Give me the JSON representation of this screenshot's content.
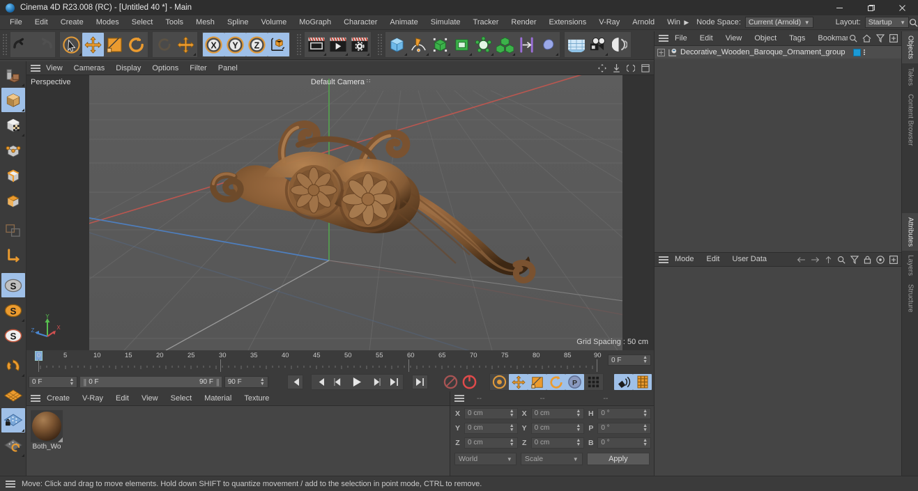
{
  "window": {
    "title": "Cinema 4D R23.008 (RC) - [Untitled 40 *] - Main",
    "minimize": "–",
    "maximize": "❐",
    "close": "✕"
  },
  "menubar": {
    "items": [
      "File",
      "Edit",
      "Create",
      "Modes",
      "Select",
      "Tools",
      "Mesh",
      "Spline",
      "Volume",
      "MoGraph",
      "Character",
      "Animate",
      "Simulate",
      "Tracker",
      "Render",
      "Extensions",
      "V-Ray",
      "Arnold",
      "Window"
    ],
    "overflow_arrow": "▶",
    "node_space_label": "Node Space:",
    "node_space_value": "Current (Arnold)",
    "layout_label": "Layout:",
    "layout_value": "Startup",
    "search_icon": "search-icon"
  },
  "toolbar": {
    "groups": [
      {
        "name": "history",
        "buttons": [
          {
            "name": "undo",
            "icon": "undo-icon",
            "active": false,
            "dim": false,
            "corner": false
          },
          {
            "name": "redo",
            "icon": "redo-icon",
            "active": false,
            "dim": true,
            "corner": false
          }
        ]
      },
      {
        "name": "transform-tools",
        "buttons": [
          {
            "name": "select",
            "icon": "live-selection-icon",
            "active": false,
            "dim": false,
            "corner": true
          },
          {
            "name": "move",
            "icon": "move-icon",
            "active": true,
            "dim": false,
            "corner": false
          },
          {
            "name": "scale",
            "icon": "scale-icon",
            "active": false,
            "dim": false,
            "corner": false
          },
          {
            "name": "rotate",
            "icon": "rotate-icon",
            "active": false,
            "dim": false,
            "corner": false
          }
        ]
      },
      {
        "name": "axis-lock",
        "buttons": [
          {
            "name": "last-used",
            "icon": "rotate-dim-icon",
            "active": false,
            "dim": true,
            "corner": false
          },
          {
            "name": "move-dup",
            "icon": "move-icon",
            "active": false,
            "dim": false,
            "corner": true
          }
        ]
      },
      {
        "name": "axis",
        "buttons": [
          {
            "name": "x-axis",
            "icon": "x-axis-icon",
            "active": true,
            "dim": false,
            "corner": false
          },
          {
            "name": "y-axis",
            "icon": "y-axis-icon",
            "active": true,
            "dim": false,
            "corner": false
          },
          {
            "name": "z-axis",
            "icon": "z-axis-icon",
            "active": true,
            "dim": false,
            "corner": false
          },
          {
            "name": "world-object-coord",
            "icon": "world-coord-icon",
            "active": false,
            "dim": false,
            "corner": false
          }
        ]
      },
      {
        "name": "render",
        "buttons": [
          {
            "name": "render-view",
            "icon": "render-view-icon",
            "active": false,
            "dim": false,
            "corner": true
          },
          {
            "name": "render-to-picture-viewer",
            "icon": "render-picture-viewer-icon",
            "active": false,
            "dim": false,
            "corner": true
          },
          {
            "name": "render-settings",
            "icon": "render-settings-icon",
            "active": false,
            "dim": false,
            "corner": true
          }
        ]
      },
      {
        "name": "create",
        "buttons": [
          {
            "name": "add-cube",
            "icon": "cube-icon",
            "active": false,
            "dim": false,
            "corner": true
          },
          {
            "name": "add-spline",
            "icon": "pen-spline-icon",
            "active": false,
            "dim": false,
            "corner": true
          },
          {
            "name": "add-nurbs",
            "icon": "generator-icon",
            "active": false,
            "dim": false,
            "corner": true
          },
          {
            "name": "add-array",
            "icon": "modeling-object-icon",
            "active": false,
            "dim": false,
            "corner": true
          },
          {
            "name": "add-deformer",
            "icon": "deformer-icon",
            "active": false,
            "dim": false,
            "corner": true
          },
          {
            "name": "add-mograph",
            "icon": "mograph-cloner-icon",
            "active": false,
            "dim": false,
            "corner": true
          },
          {
            "name": "add-scene",
            "icon": "scene-icon",
            "active": false,
            "dim": false,
            "corner": false
          },
          {
            "name": "add-field",
            "icon": "field-icon",
            "active": false,
            "dim": false,
            "corner": true
          }
        ]
      },
      {
        "name": "lighting",
        "buttons": [
          {
            "name": "add-sky",
            "icon": "sky-icon",
            "active": false,
            "dim": false,
            "corner": false
          },
          {
            "name": "add-camera",
            "icon": "camera-icon",
            "active": false,
            "dim": false,
            "corner": true
          },
          {
            "name": "add-light",
            "icon": "light-icon",
            "active": false,
            "dim": false,
            "corner": true
          }
        ]
      }
    ]
  },
  "left_toolbar": {
    "buttons": [
      {
        "name": "make-editable",
        "icon": "make-editable-icon",
        "active": false,
        "corner": true
      },
      {
        "name": "model-mode",
        "icon": "model-mode-icon",
        "active": true,
        "corner": true
      },
      {
        "name": "texture-mode",
        "icon": "texture-mode-icon",
        "active": false,
        "corner": true
      },
      {
        "name": "point-mode",
        "icon": "point-mode-icon",
        "active": false,
        "corner": false
      },
      {
        "name": "edge-mode",
        "icon": "edge-mode-icon",
        "active": false,
        "corner": false
      },
      {
        "name": "polygon-mode",
        "icon": "polygon-mode-icon",
        "active": false,
        "corner": false
      },
      {
        "name": "viewport-solo",
        "icon": "viewport-solo-icon",
        "active": false,
        "corner": false
      },
      {
        "name": "workplane",
        "icon": "workplane-axis-icon",
        "active": false,
        "corner": false
      },
      {
        "name": "enable-axis-modification",
        "icon": "axis-s-icon",
        "active": true,
        "corner": false
      },
      {
        "name": "enable-snapping",
        "icon": "snap-s-orange-icon",
        "active": false,
        "corner": true
      },
      {
        "name": "quantize",
        "icon": "snap-s-white-icon",
        "active": false,
        "corner": false
      },
      {
        "name": "magnet",
        "icon": "magnet-icon",
        "active": false,
        "corner": true
      },
      {
        "name": "grid-visible",
        "icon": "grid-orange-icon",
        "active": false,
        "corner": false
      },
      {
        "name": "lock-workplane",
        "icon": "grid-lock-icon",
        "active": true,
        "corner": true
      },
      {
        "name": "workplane-rotate",
        "icon": "grid-rotate-icon",
        "active": false,
        "corner": true
      }
    ]
  },
  "viewport": {
    "menu": [
      "View",
      "Cameras",
      "Display",
      "Options",
      "Filter",
      "Panel"
    ],
    "corner_icons": [
      "pan-icon",
      "zoom-icon",
      "rotate-view-icon",
      "maximize-view-icon"
    ],
    "projection_label": "Perspective",
    "camera_label": "Default Camera",
    "camera_dots": "∷",
    "grid_spacing": "Grid Spacing : 50 cm",
    "axis_gizmo": {
      "x": "X",
      "y": "Y",
      "z": "Z",
      "x_color": "#d05050",
      "y_color": "#58c050",
      "z_color": "#4a86d0"
    },
    "bg_color": "#595959",
    "x_axis_color": "#c0564f",
    "z_axis_color": "#4e7fbf",
    "y_axis_color": "#55a04f",
    "model_color": "#8a6038"
  },
  "timeline": {
    "ticks": [
      "0",
      "5",
      "10",
      "15",
      "20",
      "25",
      "30",
      "35",
      "40",
      "45",
      "50",
      "55",
      "60",
      "65",
      "70",
      "75",
      "80",
      "85",
      "90"
    ],
    "major_ticks": [
      "0",
      "30",
      "60",
      "90"
    ],
    "current_frame": "0 F",
    "start_frame": "0 F",
    "range_start": "0 F",
    "range_end": "90 F",
    "end_frame": "90 F"
  },
  "transport": {
    "buttons": [
      {
        "name": "go-to-start",
        "icon": "skip-start-icon",
        "active": false
      },
      {
        "name": "go-to-previous-key",
        "icon": "prev-key-icon",
        "active": false
      },
      {
        "name": "step-back",
        "icon": "step-back-icon",
        "active": false
      },
      {
        "name": "play",
        "icon": "play-icon",
        "active": false
      },
      {
        "name": "step-forward",
        "icon": "step-forward-icon",
        "active": false
      },
      {
        "name": "go-to-next-key",
        "icon": "next-key-icon",
        "active": false
      },
      {
        "name": "go-to-end",
        "icon": "skip-end-icon",
        "active": false
      }
    ],
    "record_group": [
      {
        "name": "record-active-objects",
        "icon": "record-dim-icon",
        "active": false
      },
      {
        "name": "autokeying",
        "icon": "autokey-icon",
        "active": false
      }
    ],
    "key_group": [
      {
        "name": "keyframe-selection",
        "icon": "keyframe-gear-icon",
        "active": false
      },
      {
        "name": "position-key",
        "icon": "position-key-icon",
        "active": true
      },
      {
        "name": "scale-key",
        "icon": "scale-key-icon",
        "active": true
      },
      {
        "name": "rotation-key",
        "icon": "rotation-key-icon",
        "active": true
      },
      {
        "name": "param-key",
        "icon": "param-p-key-icon",
        "active": true
      },
      {
        "name": "point-level-animation",
        "icon": "pla-dots-icon",
        "active": false
      }
    ],
    "extra_group": [
      {
        "name": "sound-playback",
        "icon": "sound-icon",
        "active": true
      },
      {
        "name": "timeline-toggle",
        "icon": "timeline-strip-icon",
        "active": true
      }
    ]
  },
  "material_manager": {
    "menu": [
      "Create",
      "V-Ray",
      "Edit",
      "View",
      "Select",
      "Material",
      "Texture"
    ],
    "materials": [
      {
        "name": "Both_Wo",
        "color": "#7b5431"
      }
    ]
  },
  "coordinates": {
    "menu_placeholder": "--",
    "headers": [
      "--",
      "--",
      "--"
    ],
    "rows": [
      {
        "label1": "X",
        "value1": "0 cm",
        "label2": "X",
        "value2": "0 cm",
        "label3": "H",
        "value3": "0 °"
      },
      {
        "label1": "Y",
        "value1": "0 cm",
        "label2": "Y",
        "value2": "0 cm",
        "label3": "P",
        "value3": "0 °"
      },
      {
        "label1": "Z",
        "value1": "0 cm",
        "label2": "Z",
        "value2": "0 cm",
        "label3": "B",
        "value3": "0 °"
      }
    ],
    "coord_system": "World",
    "mode": "Scale",
    "apply_label": "Apply"
  },
  "object_manager": {
    "menu": [
      "File",
      "Edit",
      "View",
      "Object",
      "Tags",
      "Bookmarks"
    ],
    "icons": [
      "search-icon",
      "home-icon",
      "filter-icon",
      "add-panel-icon"
    ],
    "objects": [
      {
        "name": "Decorative_Wooden_Baroque_Ornament_group",
        "expand": "⊞",
        "tag_color": "#1b9ad6"
      }
    ]
  },
  "attributes": {
    "menu": [
      "Mode",
      "Edit",
      "User Data"
    ],
    "nav_icons": [
      "back-arrow-icon",
      "forward-arrow-icon",
      "up-arrow-icon"
    ],
    "icons": [
      "search-icon",
      "filter-icon",
      "lock-icon",
      "target-icon",
      "add-panel-icon"
    ]
  },
  "vertical_tabs": {
    "top": [
      {
        "label": "Objects",
        "active": true
      },
      {
        "label": "Takes",
        "active": false
      },
      {
        "label": "Content Browser",
        "active": false
      }
    ],
    "bottom": [
      {
        "label": "Attributes",
        "active": true
      },
      {
        "label": "Layers",
        "active": false
      },
      {
        "label": "Structure",
        "active": false
      }
    ]
  },
  "status_bar": {
    "message": "Move: Click and drag to move elements. Hold down SHIFT to quantize movement / add to the selection in point mode, CTRL to remove."
  }
}
